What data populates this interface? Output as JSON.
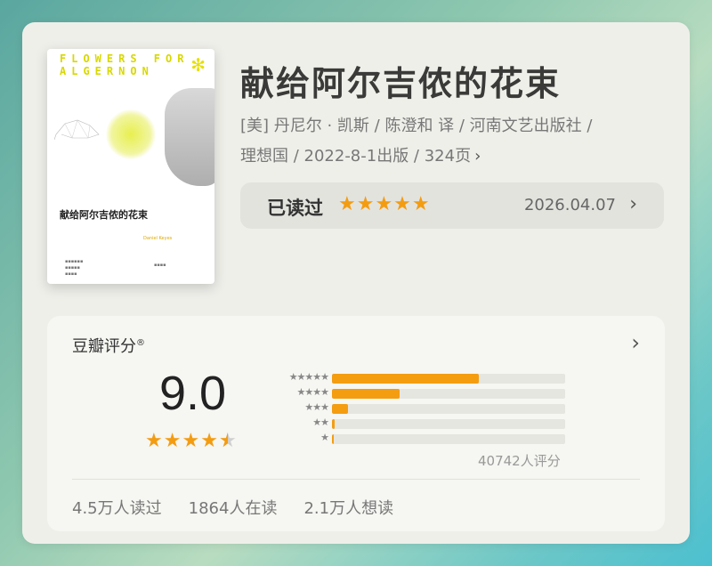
{
  "book": {
    "title": "献给阿尔吉侬的花束",
    "meta_line1": "[美] 丹尼尔 · 凯斯 / 陈澄和 译 / 河南文艺出版社 /",
    "meta_line2": "理想国 / 2022-8-1出版 / 324页",
    "cover": {
      "title_text": "献给阿尔吉侬的花束",
      "top_text": "FLOWERS FOR ALGERNON",
      "author_en": "Daniel Keyes"
    }
  },
  "read_status": {
    "label": "已读过",
    "stars": "★★★★★",
    "rating_value": 5,
    "date": "2026.04.07"
  },
  "douban": {
    "title": "豆瓣评分",
    "registered_mark": "®",
    "score": "9.0",
    "star_rating": 4.5,
    "distribution": [
      {
        "stars": "★★★★★",
        "percent": 63
      },
      {
        "stars": "★★★★",
        "percent": 29
      },
      {
        "stars": "★★★",
        "percent": 7
      },
      {
        "stars": "★★",
        "percent": 1
      },
      {
        "stars": "★",
        "percent": 0.5
      }
    ],
    "count_label": "40742人评分",
    "stats": {
      "read": "4.5万人读过",
      "reading": "1864人在读",
      "want": "2.1万人想读"
    }
  },
  "icons": {
    "chevron": "chevron-right-icon",
    "star": "star-icon"
  },
  "colors": {
    "accent": "#f49d11",
    "card_bg": "#efefea",
    "panel_bg": "#f6f6f2"
  }
}
